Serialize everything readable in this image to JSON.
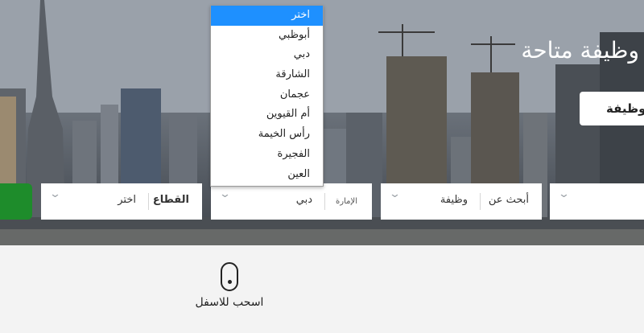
{
  "hero": {
    "headline": "وظيفة متاحة",
    "button_label": "وظيفة"
  },
  "search": {
    "keyword": {
      "label": "أبحث عن",
      "value": "وظيفة"
    },
    "emirate": {
      "label": "الإمارة",
      "value": "دبي"
    },
    "sector": {
      "label": "القطاع",
      "value": "اختر"
    }
  },
  "dropdown": {
    "options": [
      "اختر",
      "أبوظبي",
      "دبي",
      "الشارقة",
      "عجمان",
      "أم القيوين",
      "رأس الخيمة",
      "الفجيرة",
      "العين"
    ],
    "highlighted": "اختر"
  },
  "scroll_hint": {
    "text": "اسحب للاسفل"
  },
  "colors": {
    "accent_green": "#1e8c2b",
    "highlight_blue": "#1e90ff"
  }
}
